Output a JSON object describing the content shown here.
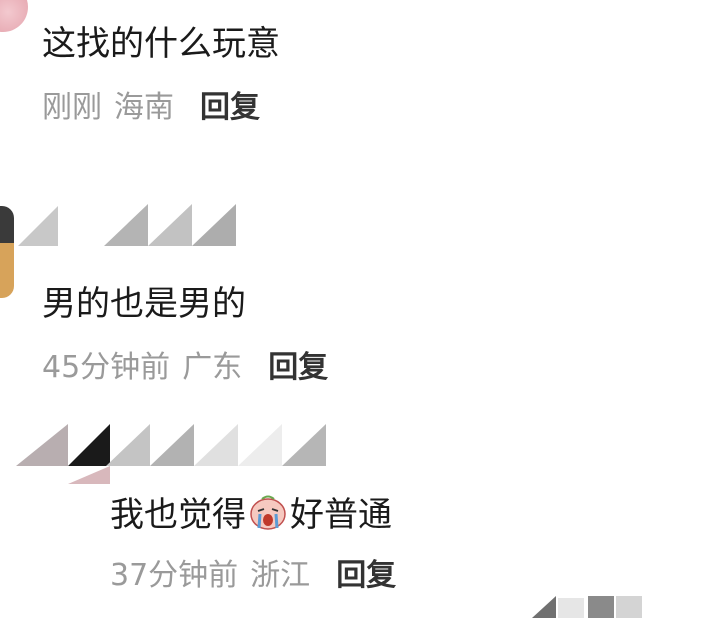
{
  "comments": [
    {
      "text": "这找的什么玩意",
      "time": "刚刚",
      "region": "海南",
      "reply_label": "回复"
    },
    {
      "text": "男的也是男的",
      "time": "45分钟前",
      "region": "广东",
      "reply_label": "回复"
    }
  ],
  "reply": {
    "text_before": "我也觉得",
    "emoji": "crying-face-sticker",
    "text_after": "好普通",
    "time": "37分钟前",
    "region": "浙江",
    "reply_label": "回复"
  },
  "colors": {
    "text": "#1a1a1a",
    "meta": "#9a9a9a",
    "reply": "#333333",
    "mosaic": "#b8b8b8"
  }
}
